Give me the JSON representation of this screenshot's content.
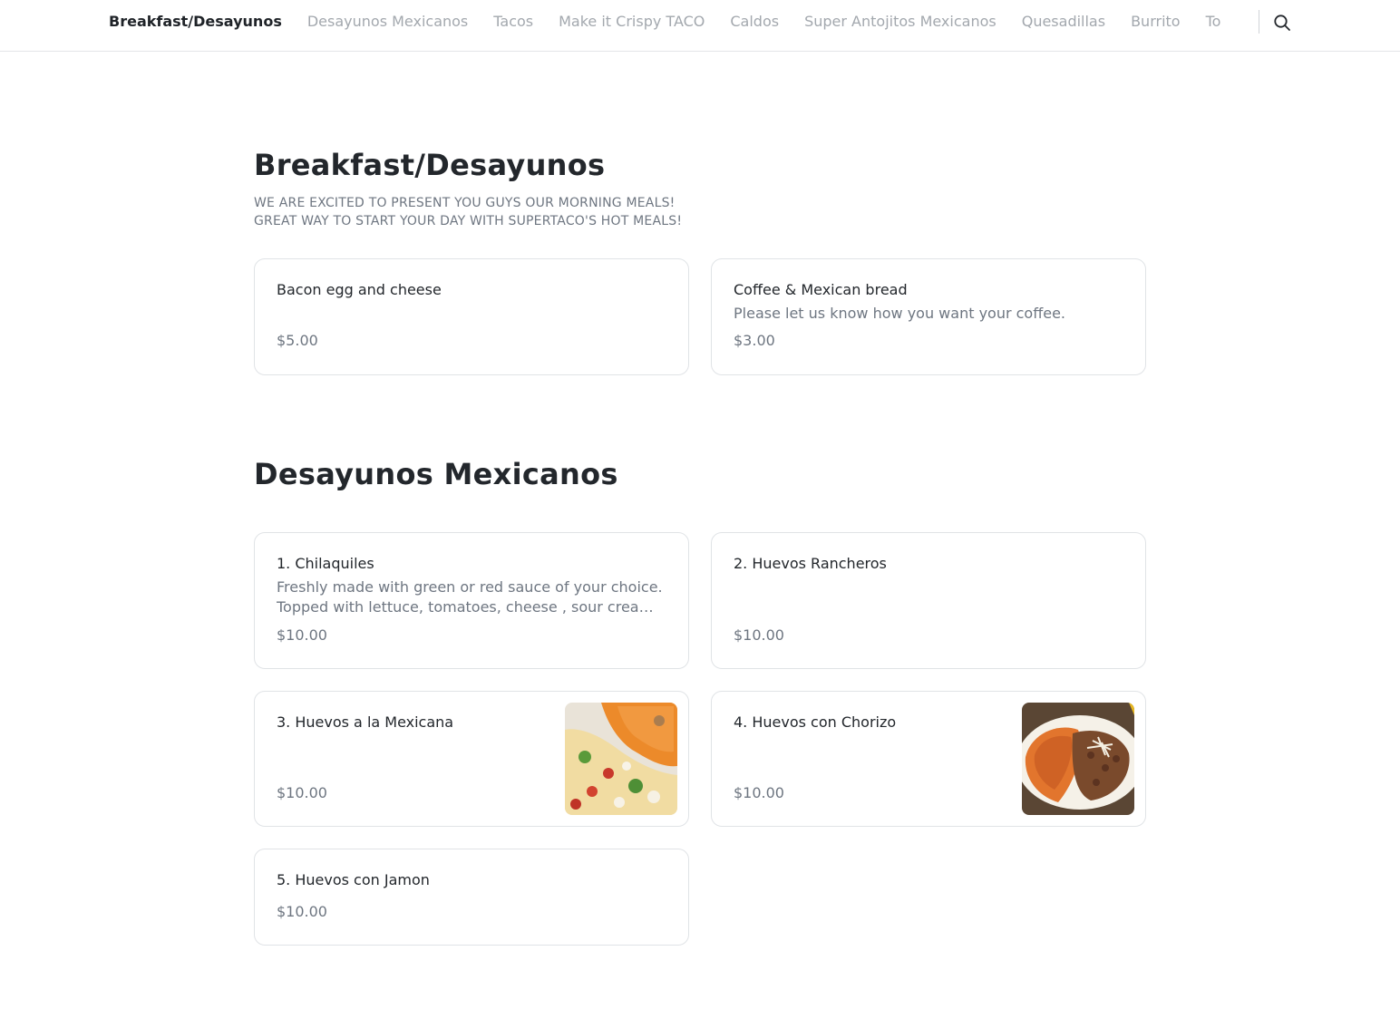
{
  "nav": {
    "categories": [
      {
        "label": "Breakfast/Desayunos",
        "active": true
      },
      {
        "label": "Desayunos Mexicanos",
        "active": false
      },
      {
        "label": "Tacos",
        "active": false
      },
      {
        "label": "Make it Crispy TACO",
        "active": false
      },
      {
        "label": "Caldos",
        "active": false
      },
      {
        "label": "Super Antojitos Mexicanos",
        "active": false
      },
      {
        "label": "Quesadillas",
        "active": false
      },
      {
        "label": "Burrito",
        "active": false
      },
      {
        "label": "To",
        "active": false
      }
    ],
    "search_icon": "search-icon"
  },
  "sections": [
    {
      "title": "Breakfast/Desayunos",
      "description": "WE ARE EXCITED TO PRESENT YOU GUYS OUR MORNING MEALS!\nGREAT WAY TO START YOUR DAY WITH SUPERTACO'S HOT MEALS!",
      "items": [
        {
          "name": "Bacon egg and cheese",
          "description": "",
          "price": "$5.00"
        },
        {
          "name": "Coffee & Mexican bread",
          "description": "Please let us know how you want your coffee.",
          "price": "$3.00"
        }
      ]
    },
    {
      "title": "Desayunos Mexicanos",
      "description": "",
      "items": [
        {
          "name": "1. Chilaquiles",
          "description": "Freshly made with green or red sauce of your choice. Topped with lettuce, tomatoes, cheese , sour cream and onions.",
          "price": "$10.00"
        },
        {
          "name": "2. Huevos Rancheros",
          "description": "",
          "price": "$10.00"
        },
        {
          "name": "3. Huevos a la Mexicana",
          "description": "",
          "price": "$10.00",
          "photo": "scrambled-eggs-with-rice-photo"
        },
        {
          "name": "4. Huevos con Chorizo",
          "description": "",
          "price": "$10.00",
          "photo": "chorizo-eggs-with-beans-photo"
        },
        {
          "name": "5. Huevos con Jamon",
          "description": "",
          "price": "$10.00"
        }
      ]
    }
  ],
  "colors": {
    "text_primary": "#1f2328",
    "text_muted": "#6e7681",
    "nav_inactive": "#a3a8ae",
    "card_border": "#e0e3e6"
  }
}
